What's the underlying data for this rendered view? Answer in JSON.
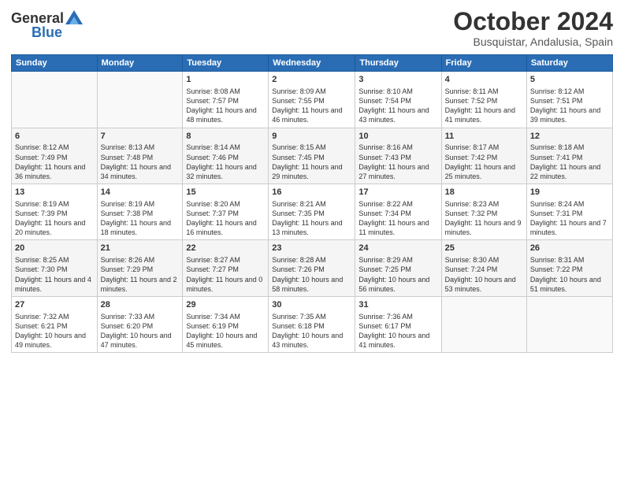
{
  "header": {
    "logo_general": "General",
    "logo_blue": "Blue",
    "month_title": "October 2024",
    "location": "Busquistar, Andalusia, Spain"
  },
  "weekdays": [
    "Sunday",
    "Monday",
    "Tuesday",
    "Wednesday",
    "Thursday",
    "Friday",
    "Saturday"
  ],
  "weeks": [
    [
      {
        "day": "",
        "sunrise": "",
        "sunset": "",
        "daylight": ""
      },
      {
        "day": "",
        "sunrise": "",
        "sunset": "",
        "daylight": ""
      },
      {
        "day": "1",
        "sunrise": "Sunrise: 8:08 AM",
        "sunset": "Sunset: 7:57 PM",
        "daylight": "Daylight: 11 hours and 48 minutes."
      },
      {
        "day": "2",
        "sunrise": "Sunrise: 8:09 AM",
        "sunset": "Sunset: 7:55 PM",
        "daylight": "Daylight: 11 hours and 46 minutes."
      },
      {
        "day": "3",
        "sunrise": "Sunrise: 8:10 AM",
        "sunset": "Sunset: 7:54 PM",
        "daylight": "Daylight: 11 hours and 43 minutes."
      },
      {
        "day": "4",
        "sunrise": "Sunrise: 8:11 AM",
        "sunset": "Sunset: 7:52 PM",
        "daylight": "Daylight: 11 hours and 41 minutes."
      },
      {
        "day": "5",
        "sunrise": "Sunrise: 8:12 AM",
        "sunset": "Sunset: 7:51 PM",
        "daylight": "Daylight: 11 hours and 39 minutes."
      }
    ],
    [
      {
        "day": "6",
        "sunrise": "Sunrise: 8:12 AM",
        "sunset": "Sunset: 7:49 PM",
        "daylight": "Daylight: 11 hours and 36 minutes."
      },
      {
        "day": "7",
        "sunrise": "Sunrise: 8:13 AM",
        "sunset": "Sunset: 7:48 PM",
        "daylight": "Daylight: 11 hours and 34 minutes."
      },
      {
        "day": "8",
        "sunrise": "Sunrise: 8:14 AM",
        "sunset": "Sunset: 7:46 PM",
        "daylight": "Daylight: 11 hours and 32 minutes."
      },
      {
        "day": "9",
        "sunrise": "Sunrise: 8:15 AM",
        "sunset": "Sunset: 7:45 PM",
        "daylight": "Daylight: 11 hours and 29 minutes."
      },
      {
        "day": "10",
        "sunrise": "Sunrise: 8:16 AM",
        "sunset": "Sunset: 7:43 PM",
        "daylight": "Daylight: 11 hours and 27 minutes."
      },
      {
        "day": "11",
        "sunrise": "Sunrise: 8:17 AM",
        "sunset": "Sunset: 7:42 PM",
        "daylight": "Daylight: 11 hours and 25 minutes."
      },
      {
        "day": "12",
        "sunrise": "Sunrise: 8:18 AM",
        "sunset": "Sunset: 7:41 PM",
        "daylight": "Daylight: 11 hours and 22 minutes."
      }
    ],
    [
      {
        "day": "13",
        "sunrise": "Sunrise: 8:19 AM",
        "sunset": "Sunset: 7:39 PM",
        "daylight": "Daylight: 11 hours and 20 minutes."
      },
      {
        "day": "14",
        "sunrise": "Sunrise: 8:19 AM",
        "sunset": "Sunset: 7:38 PM",
        "daylight": "Daylight: 11 hours and 18 minutes."
      },
      {
        "day": "15",
        "sunrise": "Sunrise: 8:20 AM",
        "sunset": "Sunset: 7:37 PM",
        "daylight": "Daylight: 11 hours and 16 minutes."
      },
      {
        "day": "16",
        "sunrise": "Sunrise: 8:21 AM",
        "sunset": "Sunset: 7:35 PM",
        "daylight": "Daylight: 11 hours and 13 minutes."
      },
      {
        "day": "17",
        "sunrise": "Sunrise: 8:22 AM",
        "sunset": "Sunset: 7:34 PM",
        "daylight": "Daylight: 11 hours and 11 minutes."
      },
      {
        "day": "18",
        "sunrise": "Sunrise: 8:23 AM",
        "sunset": "Sunset: 7:32 PM",
        "daylight": "Daylight: 11 hours and 9 minutes."
      },
      {
        "day": "19",
        "sunrise": "Sunrise: 8:24 AM",
        "sunset": "Sunset: 7:31 PM",
        "daylight": "Daylight: 11 hours and 7 minutes."
      }
    ],
    [
      {
        "day": "20",
        "sunrise": "Sunrise: 8:25 AM",
        "sunset": "Sunset: 7:30 PM",
        "daylight": "Daylight: 11 hours and 4 minutes."
      },
      {
        "day": "21",
        "sunrise": "Sunrise: 8:26 AM",
        "sunset": "Sunset: 7:29 PM",
        "daylight": "Daylight: 11 hours and 2 minutes."
      },
      {
        "day": "22",
        "sunrise": "Sunrise: 8:27 AM",
        "sunset": "Sunset: 7:27 PM",
        "daylight": "Daylight: 11 hours and 0 minutes."
      },
      {
        "day": "23",
        "sunrise": "Sunrise: 8:28 AM",
        "sunset": "Sunset: 7:26 PM",
        "daylight": "Daylight: 10 hours and 58 minutes."
      },
      {
        "day": "24",
        "sunrise": "Sunrise: 8:29 AM",
        "sunset": "Sunset: 7:25 PM",
        "daylight": "Daylight: 10 hours and 56 minutes."
      },
      {
        "day": "25",
        "sunrise": "Sunrise: 8:30 AM",
        "sunset": "Sunset: 7:24 PM",
        "daylight": "Daylight: 10 hours and 53 minutes."
      },
      {
        "day": "26",
        "sunrise": "Sunrise: 8:31 AM",
        "sunset": "Sunset: 7:22 PM",
        "daylight": "Daylight: 10 hours and 51 minutes."
      }
    ],
    [
      {
        "day": "27",
        "sunrise": "Sunrise: 7:32 AM",
        "sunset": "Sunset: 6:21 PM",
        "daylight": "Daylight: 10 hours and 49 minutes."
      },
      {
        "day": "28",
        "sunrise": "Sunrise: 7:33 AM",
        "sunset": "Sunset: 6:20 PM",
        "daylight": "Daylight: 10 hours and 47 minutes."
      },
      {
        "day": "29",
        "sunrise": "Sunrise: 7:34 AM",
        "sunset": "Sunset: 6:19 PM",
        "daylight": "Daylight: 10 hours and 45 minutes."
      },
      {
        "day": "30",
        "sunrise": "Sunrise: 7:35 AM",
        "sunset": "Sunset: 6:18 PM",
        "daylight": "Daylight: 10 hours and 43 minutes."
      },
      {
        "day": "31",
        "sunrise": "Sunrise: 7:36 AM",
        "sunset": "Sunset: 6:17 PM",
        "daylight": "Daylight: 10 hours and 41 minutes."
      },
      {
        "day": "",
        "sunrise": "",
        "sunset": "",
        "daylight": ""
      },
      {
        "day": "",
        "sunrise": "",
        "sunset": "",
        "daylight": ""
      }
    ]
  ]
}
